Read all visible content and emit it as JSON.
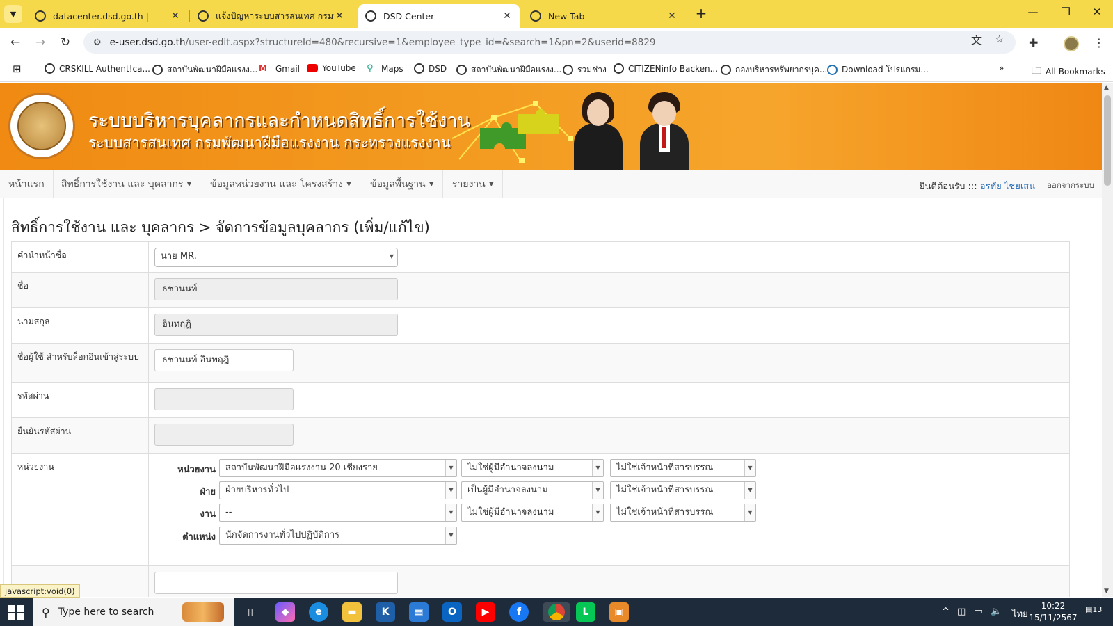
{
  "browser": {
    "tabs": [
      {
        "title": "datacenter.dsd.go.th |",
        "active": false
      },
      {
        "title": "แจ้งปัญหาระบบสารสนเทศ กรมพัฒน",
        "active": false
      },
      {
        "title": "DSD Center",
        "active": true
      },
      {
        "title": "New Tab",
        "active": false
      }
    ],
    "url_host": "e-user.dsd.go.th",
    "url_path": "/user-edit.aspx?structureId=480&recursive=1&employee_type_id=&search=1&pn=2&userid=8829",
    "bookmarks": [
      {
        "label": "CRSKILL Authent!ca...",
        "icon": "globe-icon"
      },
      {
        "label": "สถาบันพัฒนาฝีมือแรงง...",
        "icon": "globe-icon"
      },
      {
        "label": "Gmail",
        "icon": "gmail-icon"
      },
      {
        "label": "YouTube",
        "icon": "youtube-icon"
      },
      {
        "label": "Maps",
        "icon": "maps-pin-icon"
      },
      {
        "label": "DSD",
        "icon": "globe-icon"
      },
      {
        "label": "สถาบันพัฒนาฝีมือแรงง...",
        "icon": "globe-icon"
      },
      {
        "label": "รวมช่าง",
        "icon": "globe-icon"
      },
      {
        "label": "CITIZENinfo Backen...",
        "icon": "globe-icon"
      },
      {
        "label": "กองบริหารทรัพยากรบุค...",
        "icon": "globe-icon"
      },
      {
        "label": "Download โปรแกรม...",
        "icon": "wordpress-icon"
      }
    ],
    "all_bookmarks": "All Bookmarks",
    "status_text": "javascript:void(0)"
  },
  "site": {
    "banner_title": "ระบบบริหารบุคลากรและกำหนดสิทธิ์การใช้งาน",
    "banner_subtitle": "ระบบสารสนเทศ กรมพัฒนาฝีมือแรงงาน กระทรวงแรงงาน",
    "nav": [
      {
        "label": "หน้าแรก",
        "dropdown": false
      },
      {
        "label": "สิทธิ์การใช้งาน และ บุคลากร",
        "dropdown": true
      },
      {
        "label": "ข้อมูลหน่วยงาน และ โครงสร้าง",
        "dropdown": true
      },
      {
        "label": "ข้อมูลพื้นฐาน",
        "dropdown": true
      },
      {
        "label": "รายงาน",
        "dropdown": true
      }
    ],
    "welcome_label": "ยินดีต้อนรับ :::",
    "welcome_user": "อรทัย ไชยเสน",
    "logout_label": "ออกจากระบบ"
  },
  "page": {
    "title": "สิทธิ์การใช้งาน และ บุคลากร > จัดการข้อมูลบุคลากร (เพิ่ม/แก้ไข)"
  },
  "form": {
    "prefix_label": "คำนำหน้าชื่อ",
    "prefix_value": "นาย MR.",
    "firstname_label": "ชื่อ",
    "firstname_value": "ธชานนท์",
    "lastname_label": "นามสกุล",
    "lastname_value": "อินทฤฎิ",
    "username_label": "ชื่อผู้ใช้ สำหรับล็อกอินเข้าสู่ระบบ",
    "username_value": "ธชานนท์  อินทฤฎิ",
    "password_label": "รหัสผ่าน",
    "confirm_label": "ยืนยันรหัสผ่าน",
    "unit_label": "หน่วยงาน",
    "org": {
      "unit": {
        "label": "หน่วยงาน",
        "value": "สถาบันพัฒนาฝีมือแรงงาน 20 เชียงราย",
        "sign": "ไม่ใช่ผู้มีอำนาจลงนาม",
        "doc": "ไม่ใช่เจ้าหน้าที่สารบรรณ"
      },
      "division": {
        "label": "ฝ่าย",
        "value": "ฝ่ายบริหารทั่วไป",
        "sign": "เป็นผู้มีอำนาจลงนาม",
        "doc": "ไม่ใช่เจ้าหน้าที่สารบรรณ"
      },
      "work": {
        "label": "งาน",
        "value": "--",
        "sign": "ไม่ใช่ผู้มีอำนาจลงนาม",
        "doc": "ไม่ใช่เจ้าหน้าที่สารบรรณ"
      },
      "position": {
        "label": "ตำแหน่ง",
        "value": "นักจัดการงานทั่วไปปฏิบัติการ"
      }
    }
  },
  "taskbar": {
    "search_placeholder": "Type here to search",
    "lang": "ไทย",
    "time": "10:22",
    "date": "15/11/2567",
    "notifications": "13"
  }
}
